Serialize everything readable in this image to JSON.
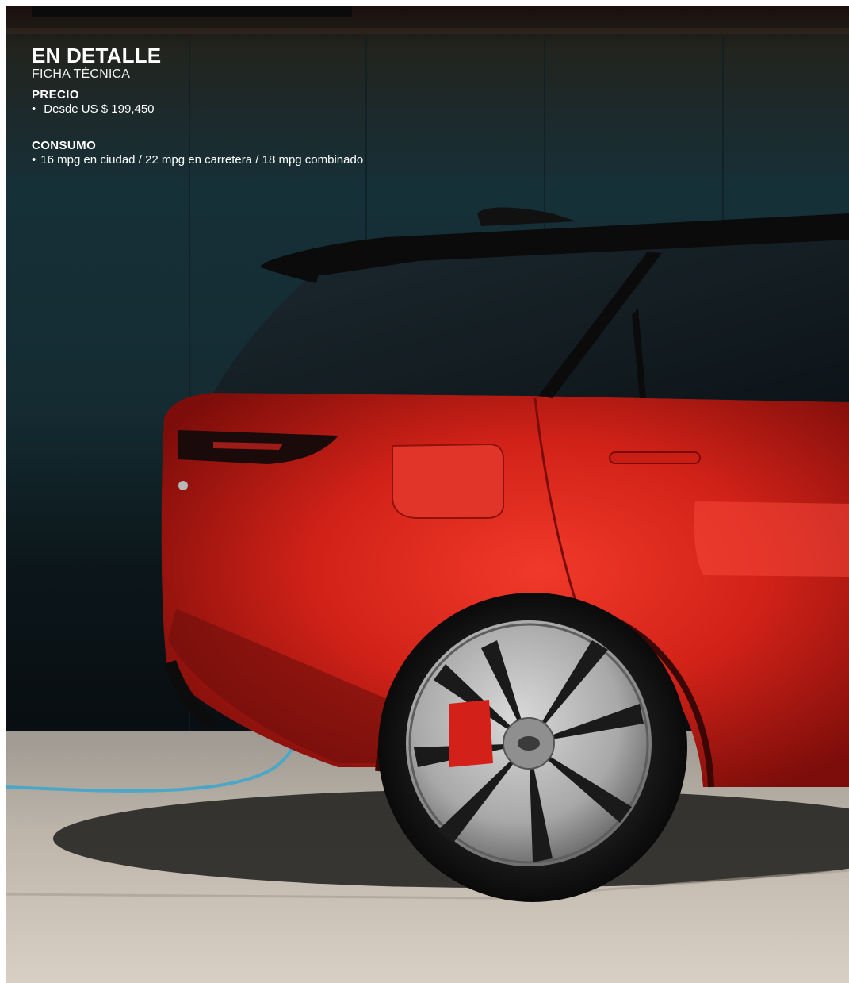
{
  "header": {
    "title": "EN DETALLE",
    "subtitle": "FICHA TÉCNICA"
  },
  "sections": [
    {
      "label": "PRECIO",
      "bullet": "•",
      "text": "Desde US $ 199,450"
    },
    {
      "label": "CONSUMO",
      "bullet": "•",
      "text": "16 mpg en ciudad / 22 mpg en carretera / 18 mpg combinado"
    }
  ],
  "colors": {
    "car_body": "#d8261c",
    "wall": "#14252c",
    "ground": "#b8b1a6"
  }
}
